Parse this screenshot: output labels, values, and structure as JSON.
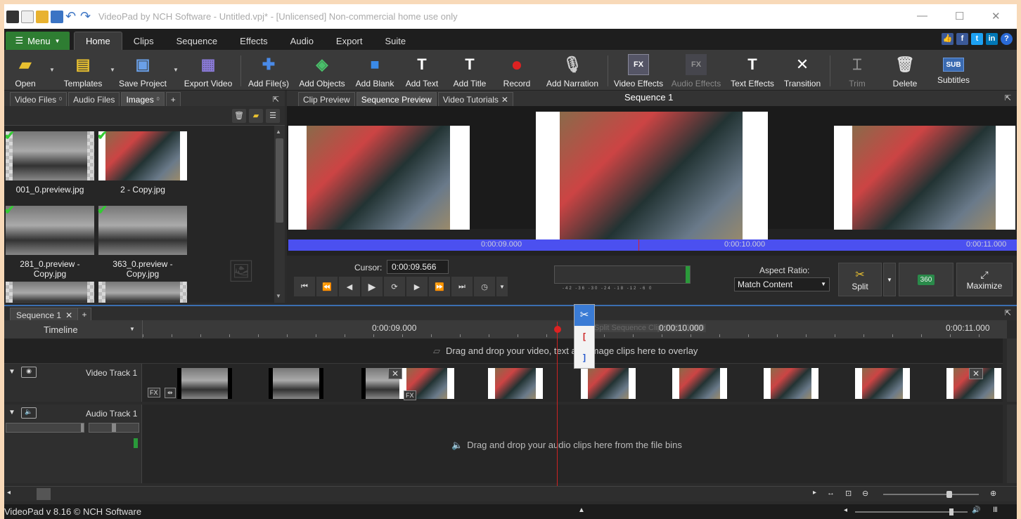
{
  "window": {
    "title": "VideoPad by NCH Software - Untitled.vpj* - [Unlicensed] Non-commercial home use only",
    "minimize": "—",
    "maximize": "☐",
    "close": "✕"
  },
  "menu": {
    "menu_label": "Menu",
    "tabs": [
      "Home",
      "Clips",
      "Sequence",
      "Effects",
      "Audio",
      "Export",
      "Suite"
    ],
    "active_tab": "Home"
  },
  "social": [
    "👍",
    "f",
    "t",
    "in",
    "?"
  ],
  "ribbon": {
    "open": "Open",
    "templates": "Templates",
    "save_project": "Save Project",
    "export_video": "Export Video",
    "add_files": "Add File(s)",
    "add_objects": "Add Objects",
    "add_blank": "Add Blank",
    "add_text": "Add Text",
    "add_title": "Add Title",
    "record": "Record",
    "add_narration": "Add Narration",
    "video_effects": "Video Effects",
    "audio_effects": "Audio Effects",
    "text_effects": "Text Effects",
    "transition": "Transition",
    "trim": "Trim",
    "delete": "Delete",
    "subtitles": "Subtitles",
    "fx_badge": "FX",
    "sub_badge": "SUB"
  },
  "bin": {
    "tabs": [
      {
        "label": "Video Files",
        "count": "0"
      },
      {
        "label": "Audio Files",
        "count": ""
      },
      {
        "label": "Images",
        "count": "0"
      }
    ],
    "add_tab": "+",
    "items": [
      {
        "label": "001_0.preview.jpg"
      },
      {
        "label": "2 - Copy.jpg"
      },
      {
        "label": "281_0.preview -\nCopy.jpg"
      },
      {
        "label": "363_0.preview -\nCopy.jpg"
      }
    ]
  },
  "preview": {
    "tabs": [
      "Clip Preview",
      "Sequence Preview",
      "Video Tutorials"
    ],
    "active_tab": "Sequence Preview",
    "title": "Sequence 1",
    "timebar": [
      "0:00:09.000",
      "0:00:10.000",
      "0:00:11.000"
    ],
    "cursor_label": "Cursor:",
    "cursor_value": "0:00:09.566",
    "meter_ticks": "-42 -36 -30 -24 -18 -12 -6 0",
    "aspect_label": "Aspect Ratio:",
    "aspect_value": "Match Content",
    "split": "Split",
    "v360": "360",
    "maximize": "Maximize"
  },
  "sequence": {
    "tab": "Sequence 1",
    "add": "+",
    "timeline_label": "Timeline",
    "ruler": [
      "0:00:09.000",
      "0:00:10.000",
      "0:00:11.000"
    ],
    "ruler_tooltip": "Split Sequence Clip 0:00:10.000",
    "overlay_hint": "Drag and drop your video, text and image clips here to overlay",
    "video_track": "Video Track 1",
    "audio_track": "Audio Track 1",
    "audio_hint": "Drag and drop your audio clips here from the file bins",
    "clip_fx": "FX"
  },
  "status": {
    "text": "VideoPad v 8.16 © NCH Software"
  },
  "colors": {
    "accent_blue": "#4b50f0",
    "menu_green": "#2e7d32",
    "playhead": "#cc2222"
  }
}
